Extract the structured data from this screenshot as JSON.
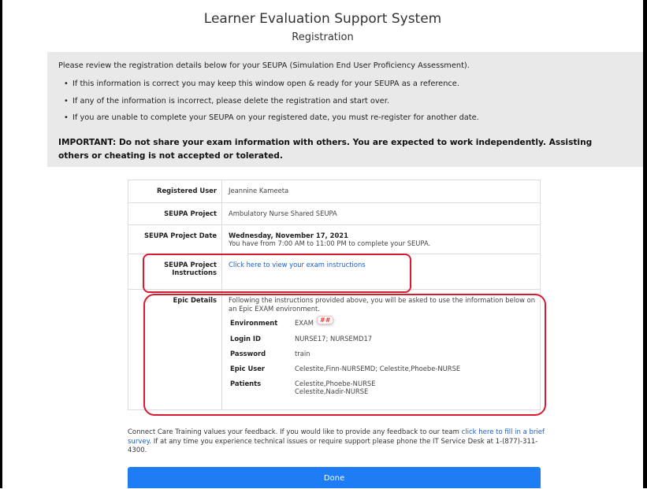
{
  "header": {
    "title": "Learner Evaluation Support System",
    "subtitle": "Registration"
  },
  "notice": {
    "intro": "Please review the registration details below for your SEUPA (Simulation End User Proficiency Assessment).",
    "bullets": [
      "If this information is correct you may keep this window open & ready for your SEUPA as a reference.",
      "If any of the information is incorrect, please delete the registration and start over.",
      "If you are unable to complete your SEUPA on your registered date, you must re-register for another date."
    ],
    "important": "IMPORTANT: Do not share your exam information with others. You are expected to work independently. Assisting others or cheating is not accepted or tolerated."
  },
  "details": {
    "registered_user_label": "Registered User",
    "registered_user": "Jeannine Kameeta",
    "project_label": "SEUPA Project",
    "project": "Ambulatory Nurse Shared SEUPA",
    "date_label": "SEUPA Project Date",
    "date": "Wednesday, November 17, 2021",
    "time_note": "You have from 7:00 AM to 11:00 PM to complete your SEUPA.",
    "instructions_label_1": "SEUPA Project",
    "instructions_label_2": "Instructions",
    "instructions_link": "Click here to view your exam instructions",
    "epic_label": "Epic Details",
    "epic_intro": "Following the instructions provided above, you will be asked to use the information below on an Epic EXAM environment.",
    "environment_label": "Environment",
    "environment": "EXAM",
    "environment_badge": "##",
    "login_label": "Login ID",
    "login": "NURSE17; NURSEMD17",
    "password_label": "Password",
    "password": "train",
    "epic_user_label": "Epic User",
    "epic_user": "Celestite,Finn-NURSEMD; Celestite,Phoebe-NURSE",
    "patients_label": "Patients",
    "patient_1": "Celestite,Phoebe-NURSE",
    "patient_2": "Celestite,Nadir-NURSE"
  },
  "feedback": {
    "text_1": "Connect Care Training values your feedback. If you would like to provide any feedback to our team ",
    "link": "click here to fill in a brief survey",
    "text_2": ". If at any time you experience technical issues or require support please phone the IT Service Desk at 1-(877)-311-4300."
  },
  "done_label": "Done",
  "colors": {
    "notice_bg": "#e9e9e9",
    "link": "#1a5fd6",
    "done_button": "#1e7cf5",
    "highlight_box": "#d81b2f"
  }
}
